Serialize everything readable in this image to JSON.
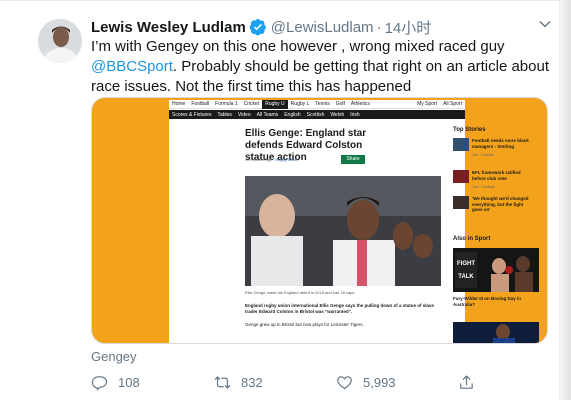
{
  "tweet": {
    "author_name": "Lewis Wesley Ludlam",
    "handle": "@LewisLudlam",
    "separator": "·",
    "time": "14小时",
    "text_lines": [
      "I’m with Gengey on this one however , wrong mixed raced guy",
      ". Probably should be getting that right on an article about",
      "race issues. Not the first time this has happened"
    ],
    "mention": "@BBCSport",
    "quoted_by": "Gengey"
  },
  "actions": {
    "reply_count": "108",
    "retweet_count": "832",
    "like_count": "5,993"
  },
  "bbc_page": {
    "nav_items": [
      "Home",
      "Football",
      "Formula 1",
      "Cricket",
      "Rugby U",
      "Rugby L",
      "Tennis",
      "Golf",
      "Athletics"
    ],
    "nav_right": [
      "My Sport",
      "All Sport"
    ],
    "subnav_items": [
      "Scores & Fixtures",
      "Tables",
      "Video",
      "All Teams",
      "English",
      "Scottish",
      "Welsh",
      "Irish"
    ],
    "headline": "Ellis Genge: England star defends Edward Colston statue action",
    "meta_time": "13 minutes ago",
    "meta_section": "Rugby Union",
    "share_label": "Share",
    "hero_caption": "Ellis Genge made his England debut in 2016 and has 18 caps",
    "para1": "England rugby union international Ellis Genge says the pulling down of a statue of slave trader Edward Colston in Bristol was \"warranted\".",
    "para2": "Genge grew up in Bristol but now plays for Leicester Tigers.",
    "top_stories_head": "Top Stories",
    "top_stories": [
      {
        "title": "Football needs more black managers - Sterling",
        "meta": "14h · Football"
      },
      {
        "title": "EFL framework ratified before club vote",
        "meta": "14m · Football"
      },
      {
        "title": "'We thought we'd changed everything, but the fight goes on'",
        "meta": ""
      }
    ],
    "also_head": "Also in Sport",
    "also_badge_top": "FIGHT",
    "also_badge_bottom": "TALK",
    "also_caption": "Fury-Wilder III on Boxing Day in Australia?"
  },
  "colors": {
    "mention_blue": "#1b95e0",
    "muted_gray": "#657786",
    "bbc_orange": "#f3a21b",
    "bbc_share_green": "#0f7a47"
  },
  "icons": [
    "verified-badge-icon",
    "chevron-down-icon",
    "reply-icon",
    "retweet-icon",
    "like-icon",
    "share-icon"
  ]
}
